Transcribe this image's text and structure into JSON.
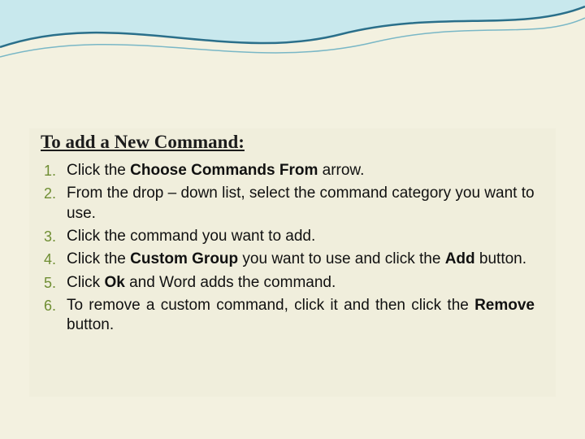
{
  "heading": "To add a New Command:",
  "steps": {
    "s1a": "Click the ",
    "s1b": "Choose Commands From ",
    "s1c": "arrow.",
    "s2": "From the drop – down list, select the command category you want to use.",
    "s3": "Click the command you want to add.",
    "s4a": "Click the ",
    "s4b": "Custom Group ",
    "s4c": "you want to use and click the ",
    "s4d": "Add",
    "s4e": " button.",
    "s5a": "Click ",
    "s5b": "Ok ",
    "s5c": "and Word adds the command.",
    "s6a": "To remove a custom command, click it and then click the ",
    "s6b": "Remove",
    "s6c": " button."
  }
}
